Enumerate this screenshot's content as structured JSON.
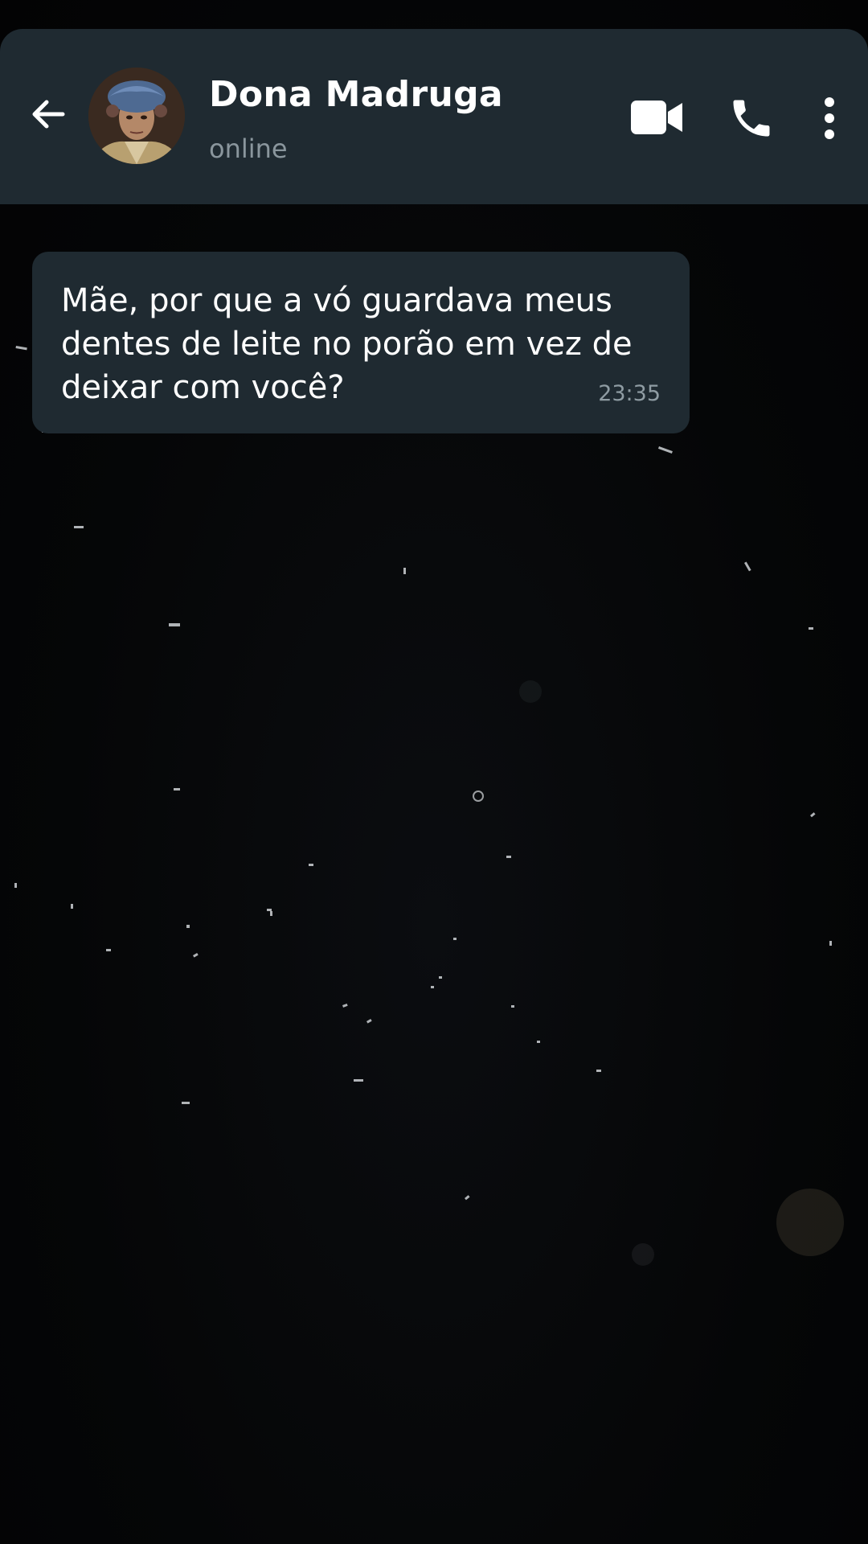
{
  "header": {
    "contact_name": "Dona Madruga",
    "status": "online",
    "icons": {
      "back": "arrow-left-icon",
      "video": "video-camera-icon",
      "call": "phone-icon",
      "menu": "more-vertical-icon"
    }
  },
  "messages": [
    {
      "text": "Mãe, por que a vó guardava meus dentes de leite no porão em vez de deixar com você?",
      "time": "23:35"
    }
  ],
  "colors": {
    "header_bg": "#1f2a31",
    "bubble_bg": "#1f2a31",
    "chat_bg": "#050607",
    "text_primary": "#ffffff",
    "text_secondary": "#8a969d"
  }
}
